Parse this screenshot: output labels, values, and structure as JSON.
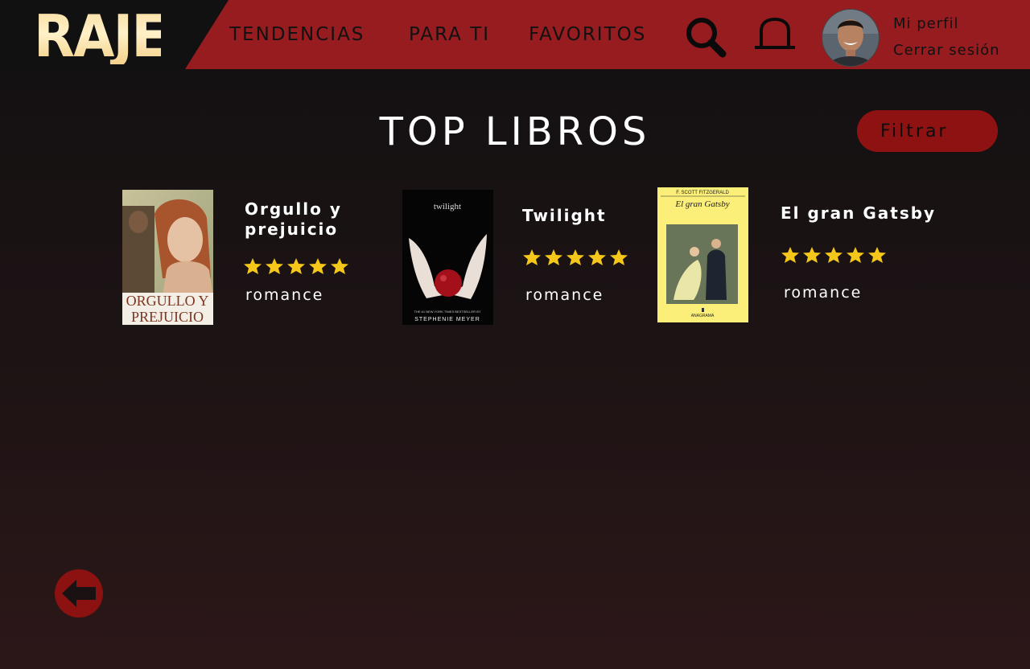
{
  "header": {
    "logo": "RAJE",
    "nav": [
      "TENDENCIAS",
      "PARA TI",
      "FAVORITOS"
    ],
    "profile_link": "Mi perfil",
    "logout_link": "Cerrar sesión",
    "icons": [
      "search-icon",
      "bell-icon"
    ]
  },
  "page": {
    "title": "TOP LIBROS",
    "filter_label": "Filtrar"
  },
  "books": [
    {
      "title": "Orgullo y prejuicio",
      "genre": "romance",
      "rating": 5,
      "cover_text": "ORGULLO Y PREJUICIO"
    },
    {
      "title": "Twilight",
      "genre": "romance",
      "rating": 5,
      "cover_title": "twilight",
      "cover_tagline": "THE #1 NEW YORK TIMES BESTSELLER BY",
      "cover_author": "STEPHENIE MEYER"
    },
    {
      "title": "El gran Gatsby",
      "genre": "romance",
      "rating": 5,
      "cover_author": "F. SCOTT FITZGERALD",
      "cover_title": "El gran Gatsby",
      "cover_publisher": "ANAGRAMA"
    }
  ],
  "colors": {
    "header_red": "#971c20",
    "accent_red": "#8f1212",
    "star_yellow": "#f5c71a",
    "logo_cream": "#fde9b8"
  },
  "icons": [
    "search-icon",
    "bell-icon",
    "star-icon",
    "back-arrow-icon",
    "avatar"
  ]
}
